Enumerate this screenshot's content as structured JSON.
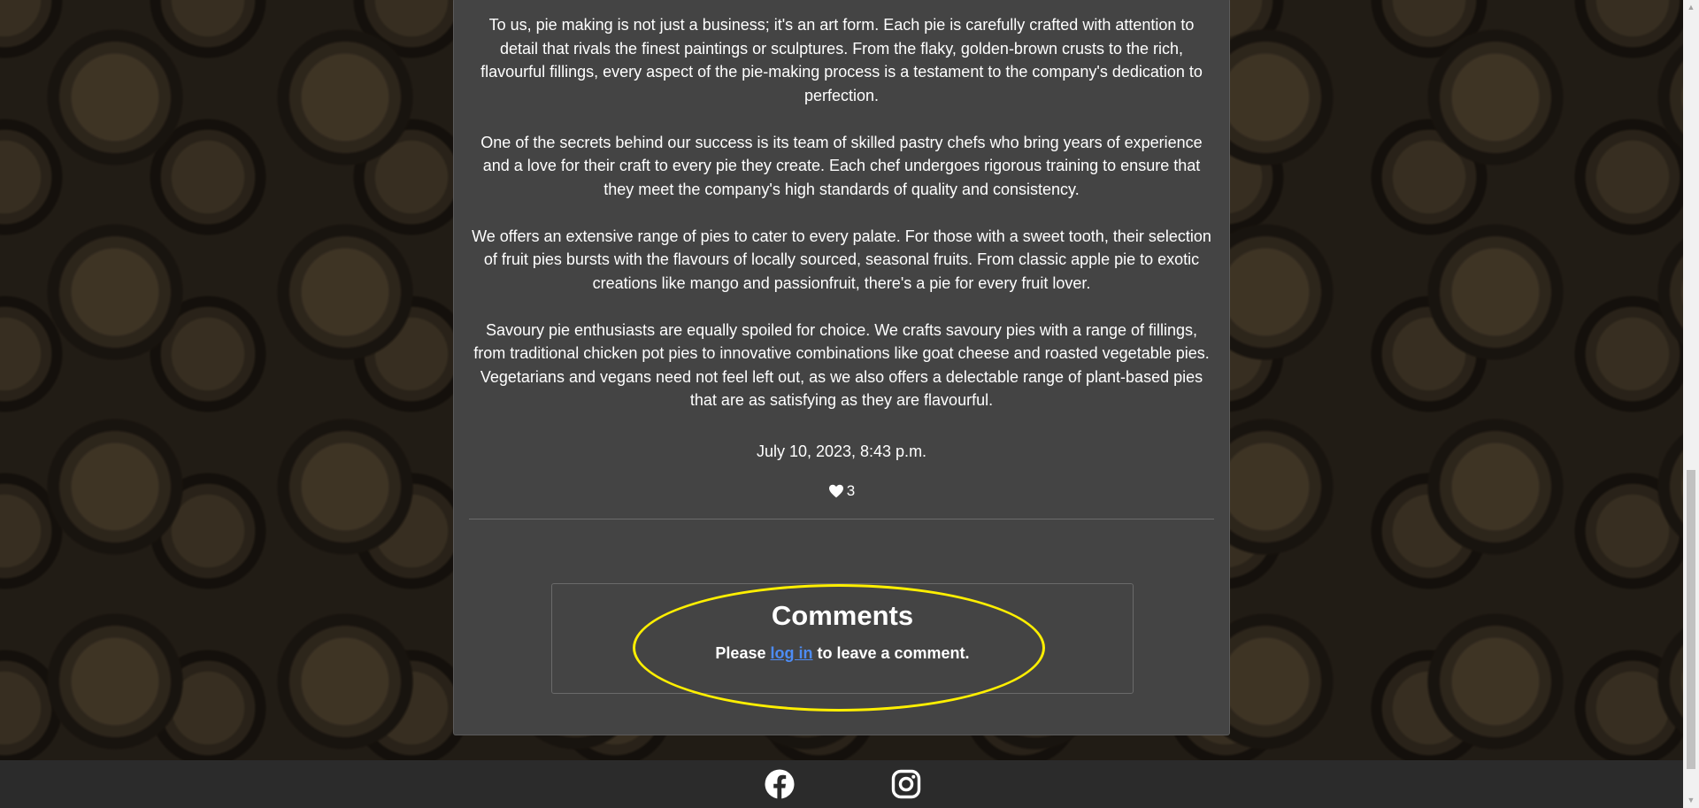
{
  "post": {
    "paragraphs": [
      "To us, pie making is not just a business; it's an art form. Each pie is carefully crafted with attention to detail that rivals the finest paintings or sculptures. From the flaky, golden-brown crusts to the rich, flavourful fillings, every aspect of the pie-making process is a testament to the company's dedication to perfection.",
      "One of the secrets behind our success is its team of skilled pastry chefs who bring years of experience and a love for their craft to every pie they create. Each chef undergoes rigorous training to ensure that they meet the company's high standards of quality and consistency.",
      "We offers an extensive range of pies to cater to every palate. For those with a sweet tooth, their selection of fruit pies bursts with the flavours of locally sourced, seasonal fruits. From classic apple pie to exotic creations like mango and passionfruit, there's a pie for every fruit lover.",
      "Savoury pie enthusiasts are equally spoiled for choice. We crafts savoury pies with a range of fillings, from traditional chicken pot pies to innovative combinations like goat cheese and roasted vegetable pies. Vegetarians and vegans need not feel left out, as we also offers a delectable range of plant-based pies that are as satisfying as they are flavourful."
    ],
    "date": "July 10, 2023, 8:43 p.m.",
    "likes_count": "3",
    "like_icon": "heart-icon"
  },
  "comments": {
    "title": "Comments",
    "prompt_before": "Please ",
    "login_link": "log in",
    "prompt_after": " to leave a comment."
  },
  "footer": {
    "icons": [
      "facebook-icon",
      "instagram-icon"
    ]
  },
  "colors": {
    "card_bg": "#444444",
    "link": "#4d8cf5",
    "highlight": "#ffef00",
    "footer_bg": "#2b2b2b"
  }
}
